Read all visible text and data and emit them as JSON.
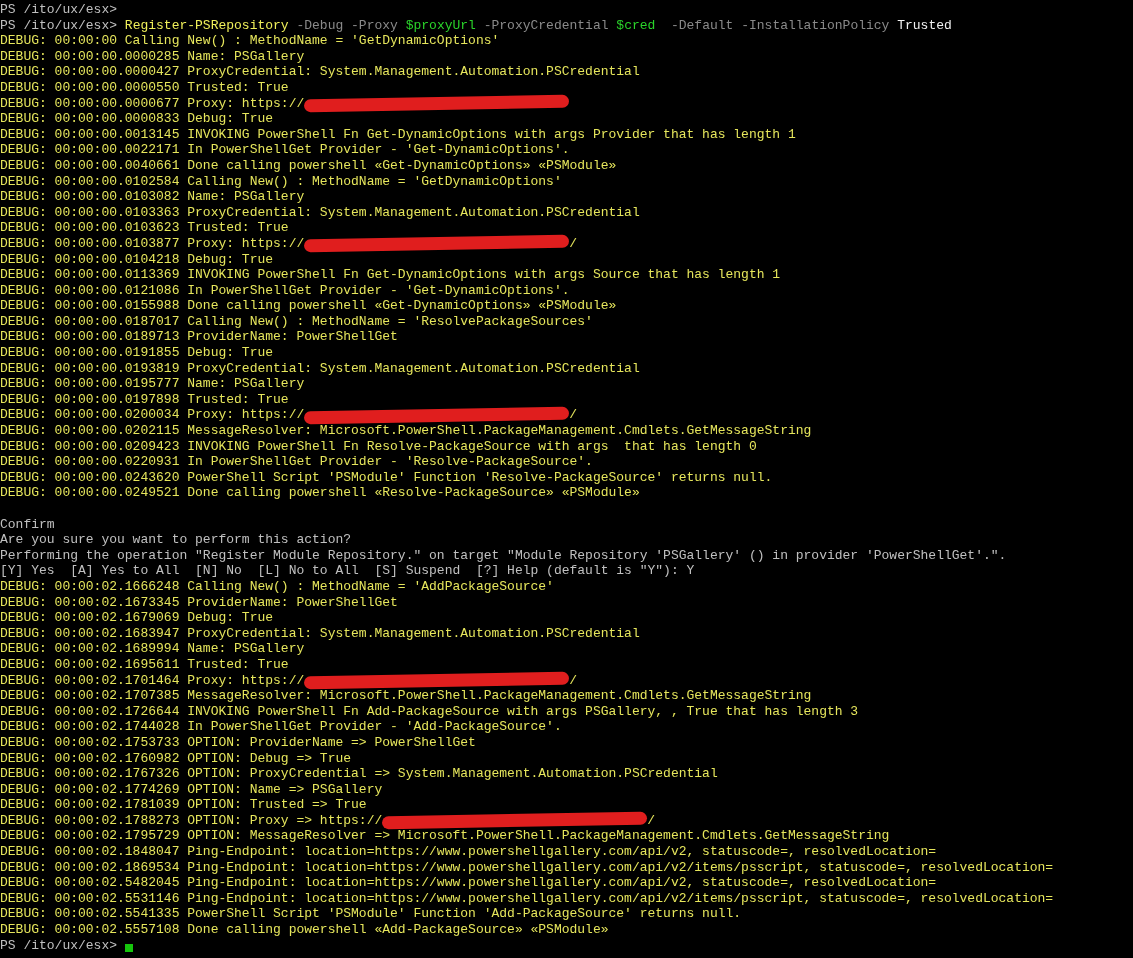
{
  "terminal": {
    "lines": [
      {
        "kind": "text",
        "text": "PS /ito/ux/esx>"
      },
      {
        "kind": "command",
        "parts": [
          {
            "kind": "prompt",
            "text": "PS /ito/ux/esx> "
          },
          {
            "kind": "cmdlet",
            "text": "Register-PSRepository"
          },
          {
            "kind": "param",
            "text": " -Debug -Proxy "
          },
          {
            "kind": "variable",
            "text": "$proxyUrl"
          },
          {
            "kind": "param",
            "text": " -ProxyCredential "
          },
          {
            "kind": "variable",
            "text": "$cred"
          },
          {
            "kind": "param",
            "text": "  -Default -InstallationPolicy "
          },
          {
            "kind": "value",
            "text": "Trusted"
          }
        ]
      },
      {
        "kind": "debug",
        "text": "DEBUG: 00:00:00 Calling New() : MethodName = 'GetDynamicOptions'"
      },
      {
        "kind": "debug",
        "text": "DEBUG: 00:00:00.0000285 Name: PSGallery"
      },
      {
        "kind": "debug",
        "text": "DEBUG: 00:00:00.0000427 ProxyCredential: System.Management.Automation.PSCredential"
      },
      {
        "kind": "debug",
        "text": "DEBUG: 00:00:00.0000550 Trusted: True"
      },
      {
        "kind": "redacted",
        "text": "DEBUG: 00:00:00.0000677 Proxy: https://"
      },
      {
        "kind": "debug",
        "text": "DEBUG: 00:00:00.0000833 Debug: True"
      },
      {
        "kind": "debug",
        "text": "DEBUG: 00:00:00.0013145 INVOKING PowerShell Fn Get-DynamicOptions with args Provider that has length 1"
      },
      {
        "kind": "debug",
        "text": "DEBUG: 00:00:00.0022171 In PowerShellGet Provider - 'Get-DynamicOptions'."
      },
      {
        "kind": "debug",
        "text": "DEBUG: 00:00:00.0040661 Done calling powershell «Get-DynamicOptions» «PSModule»"
      },
      {
        "kind": "debug",
        "text": "DEBUG: 00:00:00.0102584 Calling New() : MethodName = 'GetDynamicOptions'"
      },
      {
        "kind": "debug",
        "text": "DEBUG: 00:00:00.0103082 Name: PSGallery"
      },
      {
        "kind": "debug",
        "text": "DEBUG: 00:00:00.0103363 ProxyCredential: System.Management.Automation.PSCredential"
      },
      {
        "kind": "debug",
        "text": "DEBUG: 00:00:00.0103623 Trusted: True"
      },
      {
        "kind": "redacted",
        "text": "DEBUG: 00:00:00.0103877 Proxy: https://",
        "after": "/"
      },
      {
        "kind": "debug",
        "text": "DEBUG: 00:00:00.0104218 Debug: True"
      },
      {
        "kind": "debug",
        "text": "DEBUG: 00:00:00.0113369 INVOKING PowerShell Fn Get-DynamicOptions with args Source that has length 1"
      },
      {
        "kind": "debug",
        "text": "DEBUG: 00:00:00.0121086 In PowerShellGet Provider - 'Get-DynamicOptions'."
      },
      {
        "kind": "debug",
        "text": "DEBUG: 00:00:00.0155988 Done calling powershell «Get-DynamicOptions» «PSModule»"
      },
      {
        "kind": "debug",
        "text": "DEBUG: 00:00:00.0187017 Calling New() : MethodName = 'ResolvePackageSources'"
      },
      {
        "kind": "debug",
        "text": "DEBUG: 00:00:00.0189713 ProviderName: PowerShellGet"
      },
      {
        "kind": "debug",
        "text": "DEBUG: 00:00:00.0191855 Debug: True"
      },
      {
        "kind": "debug",
        "text": "DEBUG: 00:00:00.0193819 ProxyCredential: System.Management.Automation.PSCredential"
      },
      {
        "kind": "debug",
        "text": "DEBUG: 00:00:00.0195777 Name: PSGallery"
      },
      {
        "kind": "debug",
        "text": "DEBUG: 00:00:00.0197898 Trusted: True"
      },
      {
        "kind": "redacted",
        "text": "DEBUG: 00:00:00.0200034 Proxy: https://",
        "after": "/"
      },
      {
        "kind": "debug",
        "text": "DEBUG: 00:00:00.0202115 MessageResolver: Microsoft.PowerShell.PackageManagement.Cmdlets.GetMessageString"
      },
      {
        "kind": "debug",
        "text": "DEBUG: 00:00:00.0209423 INVOKING PowerShell Fn Resolve-PackageSource with args  that has length 0"
      },
      {
        "kind": "debug",
        "text": "DEBUG: 00:00:00.0220931 In PowerShellGet Provider - 'Resolve-PackageSource'."
      },
      {
        "kind": "debug",
        "text": "DEBUG: 00:00:00.0243620 PowerShell Script 'PSModule' Function 'Resolve-PackageSource' returns null."
      },
      {
        "kind": "debug",
        "text": "DEBUG: 00:00:00.0249521 Done calling powershell «Resolve-PackageSource» «PSModule»"
      },
      {
        "kind": "blank"
      },
      {
        "kind": "text",
        "text": "Confirm"
      },
      {
        "kind": "text",
        "text": "Are you sure you want to perform this action?"
      },
      {
        "kind": "text",
        "text": "Performing the operation \"Register Module Repository.\" on target \"Module Repository 'PSGallery' () in provider 'PowerShellGet'.\"."
      },
      {
        "kind": "text",
        "text": "[Y] Yes  [A] Yes to All  [N] No  [L] No to All  [S] Suspend  [?] Help (default is \"Y\"): Y"
      },
      {
        "kind": "debug",
        "text": "DEBUG: 00:00:02.1666248 Calling New() : MethodName = 'AddPackageSource'"
      },
      {
        "kind": "debug",
        "text": "DEBUG: 00:00:02.1673345 ProviderName: PowerShellGet"
      },
      {
        "kind": "debug",
        "text": "DEBUG: 00:00:02.1679069 Debug: True"
      },
      {
        "kind": "debug",
        "text": "DEBUG: 00:00:02.1683947 ProxyCredential: System.Management.Automation.PSCredential"
      },
      {
        "kind": "debug",
        "text": "DEBUG: 00:00:02.1689994 Name: PSGallery"
      },
      {
        "kind": "debug",
        "text": "DEBUG: 00:00:02.1695611 Trusted: True"
      },
      {
        "kind": "redacted",
        "text": "DEBUG: 00:00:02.1701464 Proxy: https://",
        "after": "/"
      },
      {
        "kind": "debug",
        "text": "DEBUG: 00:00:02.1707385 MessageResolver: Microsoft.PowerShell.PackageManagement.Cmdlets.GetMessageString"
      },
      {
        "kind": "debug",
        "text": "DEBUG: 00:00:02.1726644 INVOKING PowerShell Fn Add-PackageSource with args PSGallery, , True that has length 3"
      },
      {
        "kind": "debug",
        "text": "DEBUG: 00:00:02.1744028 In PowerShellGet Provider - 'Add-PackageSource'."
      },
      {
        "kind": "debug",
        "text": "DEBUG: 00:00:02.1753733 OPTION: ProviderName => PowerShellGet"
      },
      {
        "kind": "debug",
        "text": "DEBUG: 00:00:02.1760982 OPTION: Debug => True"
      },
      {
        "kind": "debug",
        "text": "DEBUG: 00:00:02.1767326 OPTION: ProxyCredential => System.Management.Automation.PSCredential"
      },
      {
        "kind": "debug",
        "text": "DEBUG: 00:00:02.1774269 OPTION: Name => PSGallery"
      },
      {
        "kind": "debug",
        "text": "DEBUG: 00:00:02.1781039 OPTION: Trusted => True"
      },
      {
        "kind": "redacted",
        "text": "DEBUG: 00:00:02.1788273 OPTION: Proxy => https://",
        "after": "/"
      },
      {
        "kind": "debug",
        "text": "DEBUG: 00:00:02.1795729 OPTION: MessageResolver => Microsoft.PowerShell.PackageManagement.Cmdlets.GetMessageString"
      },
      {
        "kind": "debug",
        "text": "DEBUG: 00:00:02.1848047 Ping-Endpoint: location=https://www.powershellgallery.com/api/v2, statuscode=, resolvedLocation="
      },
      {
        "kind": "debug",
        "text": "DEBUG: 00:00:02.1869534 Ping-Endpoint: location=https://www.powershellgallery.com/api/v2/items/psscript, statuscode=, resolvedLocation="
      },
      {
        "kind": "debug",
        "text": "DEBUG: 00:00:02.5482045 Ping-Endpoint: location=https://www.powershellgallery.com/api/v2, statuscode=, resolvedLocation="
      },
      {
        "kind": "debug",
        "text": "DEBUG: 00:00:02.5531146 Ping-Endpoint: location=https://www.powershellgallery.com/api/v2/items/psscript, statuscode=, resolvedLocation="
      },
      {
        "kind": "debug",
        "text": "DEBUG: 00:00:02.5541335 PowerShell Script 'PSModule' Function 'Add-PackageSource' returns null."
      },
      {
        "kind": "debug",
        "text": "DEBUG: 00:00:02.5557108 Done calling powershell «Add-PackageSource» «PSModule»"
      },
      {
        "kind": "prompt",
        "text": "PS /ito/ux/esx>"
      }
    ]
  }
}
